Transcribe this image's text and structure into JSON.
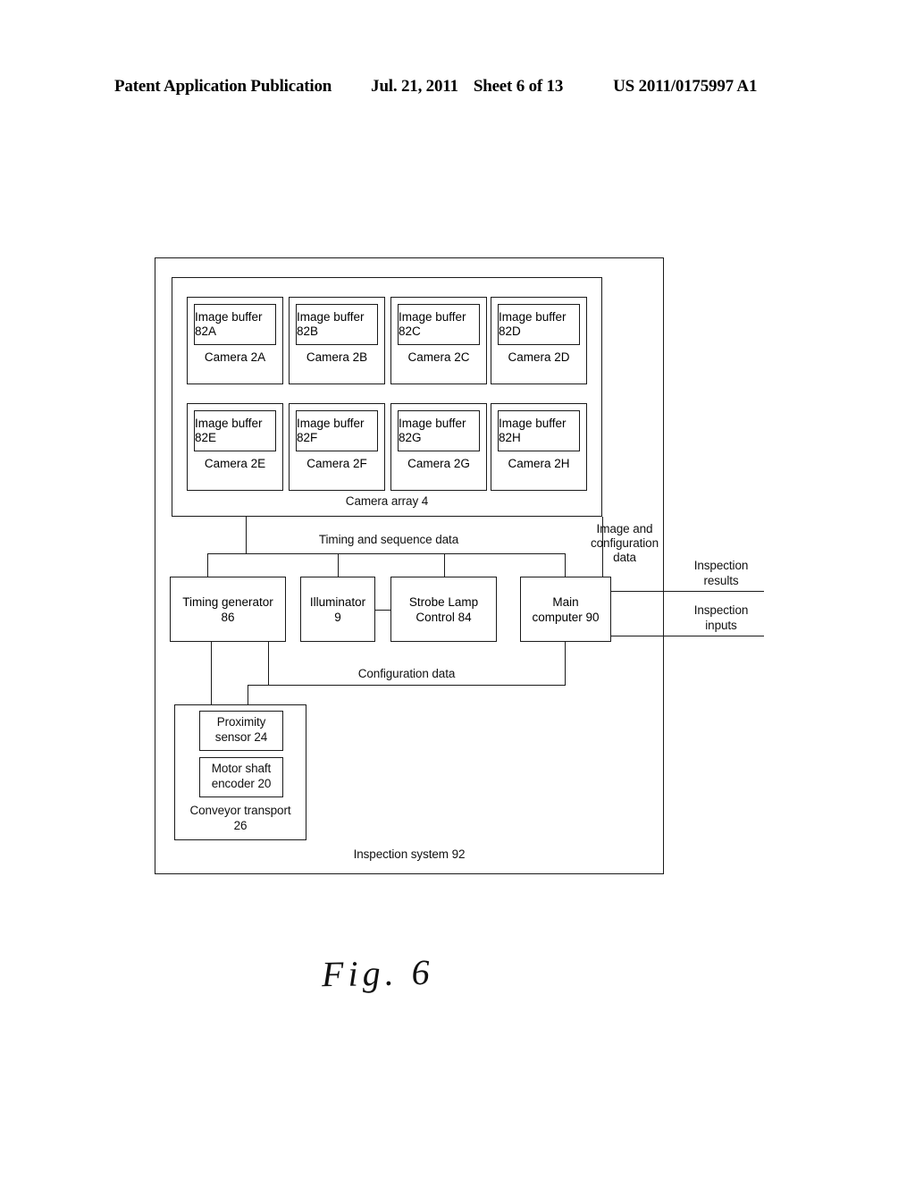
{
  "header": {
    "publication": "Patent Application Publication",
    "date": "Jul. 21, 2011",
    "sheet": "Sheet 6 of 13",
    "number": "US 2011/0175997 A1"
  },
  "figure": {
    "caption": "Fig. 6",
    "system_label": "Inspection system 92",
    "camera_array_label": "Camera array 4",
    "cameras": [
      {
        "buffer": "Image buffer\n82A",
        "camera": "Camera\n2A"
      },
      {
        "buffer": "Image buffer\n82B",
        "camera": "Camera\n2B"
      },
      {
        "buffer": "Image buffer\n82C",
        "camera": "Camera\n2C"
      },
      {
        "buffer": "Image buffer\n82D",
        "camera": "Camera\n2D"
      },
      {
        "buffer": "Image buffer\n82E",
        "camera": "Camera\n2E"
      },
      {
        "buffer": "Image buffer\n82F",
        "camera": "Camera\n2F"
      },
      {
        "buffer": "Image buffer\n82G",
        "camera": "Camera\n2G"
      },
      {
        "buffer": "Image buffer\n82H",
        "camera": "Camera\n2H"
      }
    ],
    "units": {
      "timing_generator": "Timing generator\n86",
      "illuminator": "Illuminator\n9",
      "strobe_lamp_control": "Strobe Lamp\nControl 84",
      "main_computer": "Main\ncomputer 90",
      "proximity_sensor": "Proximity\nsensor 24",
      "motor_shaft_encoder": "Motor shaft\nencoder 20",
      "conveyor_transport": "Conveyor transport\n26"
    },
    "bus_labels": {
      "timing_sequence": "Timing and sequence data",
      "image_configuration": "Image and\nconfiguration\ndata",
      "configuration": "Configuration data",
      "inspection_results": "Inspection\nresults",
      "inspection_inputs": "Inspection\ninputs"
    }
  }
}
